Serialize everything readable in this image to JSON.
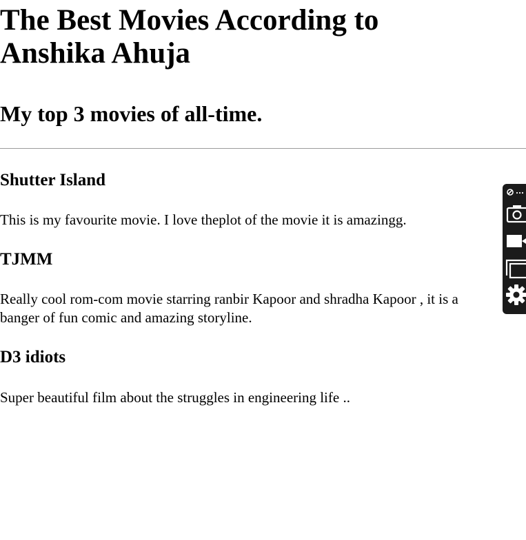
{
  "page": {
    "title_line1": "The Best Movies According to",
    "title_line2": "Anshika Ahuja",
    "subtitle": "My top 3 movies of all-time."
  },
  "movies": [
    {
      "title": "Shutter Island",
      "description": "This is my favourite movie. I love theplot of the movie it is amazingg."
    },
    {
      "title": "TJMM",
      "description": "Really cool rom-com movie starring ranbir Kapoor and shradha Kapoor , it is a banger of fun comic and amazing storyline."
    },
    {
      "title": "D3 idiots",
      "description": "Super beautiful film about the struggles in engineering life .."
    }
  ],
  "toolbar": {
    "icons": [
      "link-icon",
      "more-icon",
      "camera-icon",
      "video-icon",
      "windows-icon",
      "gear-icon"
    ],
    "background": "#1b1b1b",
    "icon_color": "#ffffff"
  }
}
